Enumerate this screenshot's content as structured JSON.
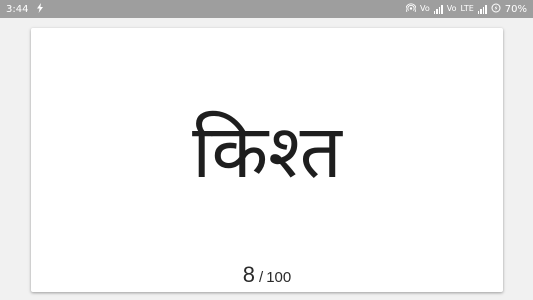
{
  "status_bar": {
    "time": "3:44",
    "flash_icon": "lightning-icon",
    "hotspot_icon": "hotspot-icon",
    "sim1_label": "Vo",
    "sim2_label": "Vo",
    "network": "LTE",
    "battery_percent": "70%",
    "background_color": "#9e9e9e"
  },
  "card": {
    "word": "किश्त",
    "current": "8",
    "separator": "/",
    "total": "100"
  }
}
